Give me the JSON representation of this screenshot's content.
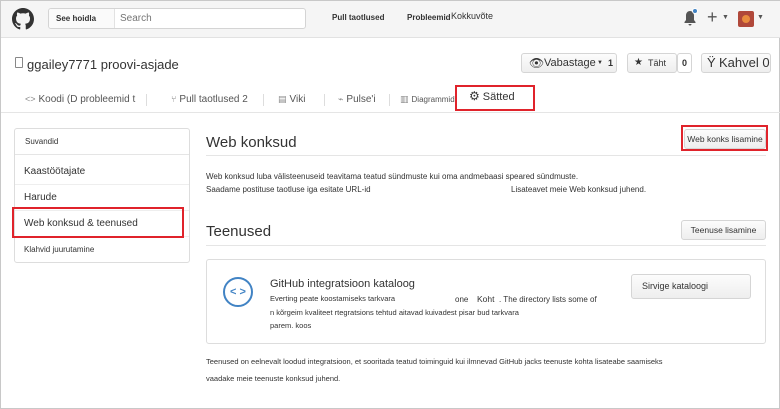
{
  "header": {
    "search_scope": "See hoidla",
    "search_placeholder": "Search",
    "nav_pull": "Pull taotlused",
    "nav_issues": "Probleemid",
    "nav_gist": "Kokkuvõte"
  },
  "repo": {
    "title": "ggailey7771 proovi-asjade",
    "watch_label": "Vabastage",
    "watch_count": "1",
    "star_label": "Täht",
    "star_count": "0",
    "fork_label": "Kahvel 0"
  },
  "tabs": {
    "code": "Koodi (D probleemid t",
    "pulls": "Pull taotlused 2",
    "wiki": "Viki",
    "pulse": "Pulse'i",
    "graphs": "Diagrammid",
    "settings": "Sätted"
  },
  "sidebar": {
    "heading": "Suvandid",
    "items": [
      {
        "label": "Kaastöötajate"
      },
      {
        "label": "Harude"
      },
      {
        "label": "Web konksud & teenused"
      },
      {
        "label": "Klahvid juurutamine"
      }
    ]
  },
  "webhooks": {
    "title": "Web konksud",
    "add_button": "Web konks lisamine",
    "desc_line1": "Web konksud luba välisteenuseid teavitama teatud sündmuste kui oma andmebaasi speared sündmuste.",
    "desc_line2a": "Saadame postituse taotluse iga esitate URL-id",
    "desc_line2b": "Lisateavet meie Web konksud juhend."
  },
  "services": {
    "title": "Teenused",
    "add_button": "Teenuse lisamine",
    "card_icon": "< >",
    "card_title": "GitHub integratsioon kataloog",
    "card_line1a": "Everting peate koostamiseks tarkvara",
    "card_line1b": "one",
    "card_line1c": "Koht",
    "card_line1d": ". The directory lists some of",
    "card_line2": "n kõrgeim kvaliteet rtegratsions tehtud aitavad kuivadest pisar bud tarkvara",
    "card_line3": "parem. koos",
    "browse_button": "Sirvige kataloogi",
    "footer_line1": "Teenused on eelnevalt loodud integratsioon, et sooritada teatud toiminguid kui ilmnevad GitHub jacks teenuste kohta lisateabe saamiseks",
    "footer_line2": "vaadake meie teenuste konksud juhend."
  },
  "colors": {
    "highlight": "#e0232b",
    "accent": "#4183c4"
  }
}
